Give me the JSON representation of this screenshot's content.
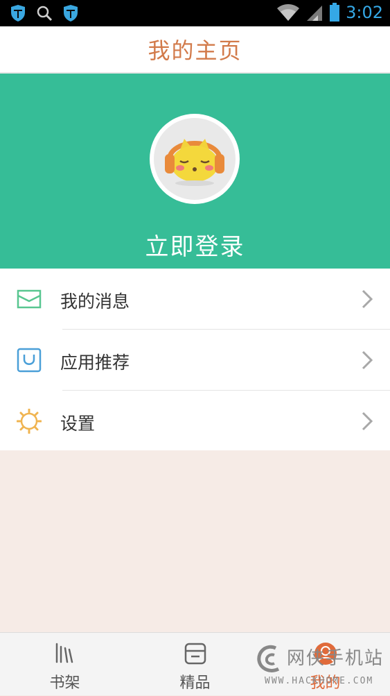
{
  "status_bar": {
    "left_icons": [
      "shield-icon",
      "search-icon",
      "shield-icon"
    ],
    "right_icons": [
      "wifi-icon",
      "signal-icon",
      "battery-icon"
    ],
    "time": "3:02"
  },
  "header": {
    "title": "我的主页"
  },
  "profile": {
    "avatar_icon": "cat-headphones-avatar",
    "login_label": "立即登录",
    "hero_color": "#36bd97"
  },
  "menu": {
    "items": [
      {
        "label": "我的消息",
        "icon": "envelope-icon"
      },
      {
        "label": "应用推荐",
        "icon": "shopping-bag-icon"
      },
      {
        "label": "设置",
        "icon": "sun-gear-icon"
      }
    ]
  },
  "tabs": [
    {
      "label": "书架",
      "icon": "bookshelf-icon",
      "active": false
    },
    {
      "label": "精品",
      "icon": "store-icon",
      "active": false
    },
    {
      "label": "我的",
      "icon": "profile-icon",
      "active": true
    }
  ],
  "watermark": {
    "main": "网侠手机站",
    "sub": "WWW.HACKHOME.COM"
  },
  "colors": {
    "accent": "#d27a4a",
    "hero": "#36bd97",
    "background": "#f6ebe6"
  }
}
